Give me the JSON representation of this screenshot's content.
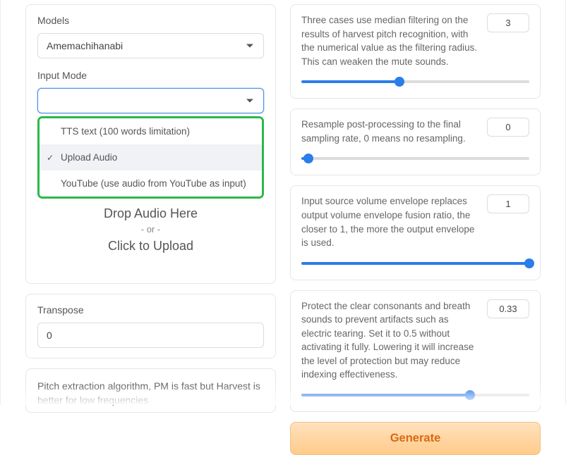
{
  "left": {
    "models_label": "Models",
    "models_value": "Amemachihanabi",
    "input_mode_label": "Input Mode",
    "input_mode_options": [
      {
        "label": "TTS text (100 words limitation)",
        "selected": false
      },
      {
        "label": "Upload Audio",
        "selected": true
      },
      {
        "label": "YouTube (use audio from YouTube as input)",
        "selected": false
      }
    ],
    "upload": {
      "line1": "Drop Audio Here",
      "line2": "- or -",
      "line3": "Click to Upload"
    },
    "transpose_label": "Transpose",
    "transpose_value": "0",
    "pitch_algo_text": "Pitch extraction algorithm, PM is fast but Harvest is better for low frequencies"
  },
  "right": {
    "param_filter": {
      "desc": "Three cases use median filtering on the results of harvest pitch recognition, with the numerical value as the filtering radius. This can weaken the mute sounds.",
      "value": "3",
      "fill_pct": 43
    },
    "param_resample": {
      "desc": "Resample post-processing to the final sampling rate, 0 means no resampling.",
      "value": "0",
      "fill_pct": 3
    },
    "param_envelope": {
      "desc": "Input source volume envelope replaces output volume envelope fusion ratio, the closer to 1, the more the output envelope is used.",
      "value": "1",
      "fill_pct": 100
    },
    "param_protect": {
      "desc": "Protect the clear consonants and breath sounds to prevent artifacts such as electric tearing. Set it to 0.5 without activating it fully. Lowering it will increase the level of protection but may reduce indexing effectiveness.",
      "value": "0.33",
      "fill_pct": 74
    },
    "generate_label": "Generate"
  }
}
